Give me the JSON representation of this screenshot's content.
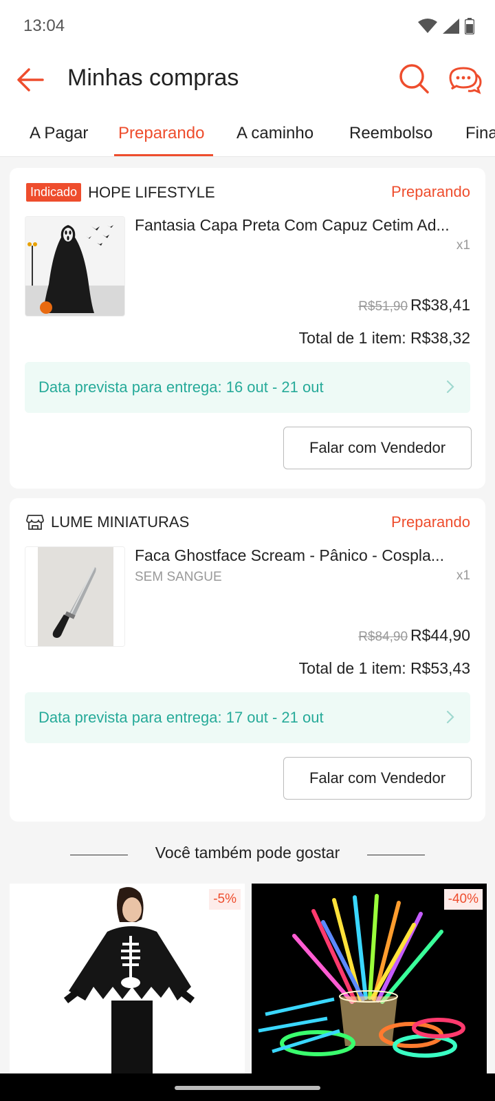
{
  "status_bar": {
    "time": "13:04"
  },
  "header": {
    "title": "Minhas compras"
  },
  "tabs": [
    {
      "label": "A Pagar"
    },
    {
      "label": "Preparando"
    },
    {
      "label": "A caminho"
    },
    {
      "label": "Reembolso"
    },
    {
      "label": "Fina"
    }
  ],
  "orders": [
    {
      "badge": "Indicado",
      "shop": "HOPE LIFESTYLE",
      "status": "Preparando",
      "product": "Fantasia Capa Preta Com Capuz Cetim Ad...",
      "variant": "",
      "qty": "x1",
      "old_price": "R$51,90",
      "price": "R$38,41",
      "total": "Total de 1 item: R$38,32",
      "delivery": "Data prevista para entrega: 16 out - 21 out",
      "button": "Falar com Vendedor"
    },
    {
      "shop": "LUME MINIATURAS",
      "status": "Preparando",
      "product": "Faca Ghostface Scream - Pânico - Cospla...",
      "variant": "SEM SANGUE",
      "qty": "x1",
      "old_price": "R$84,90",
      "price": "R$44,90",
      "total": "Total de 1 item: R$53,43",
      "delivery": "Data prevista para entrega: 17 out - 21 out",
      "button": "Falar com Vendedor"
    }
  ],
  "recommendations": {
    "title": "Você também pode gostar",
    "items": [
      {
        "discount": "-5%"
      },
      {
        "discount": "-40%"
      }
    ]
  },
  "colors": {
    "accent": "#ee4d2d",
    "delivery_text": "#26aa99",
    "delivery_bg": "#eefaf6"
  }
}
